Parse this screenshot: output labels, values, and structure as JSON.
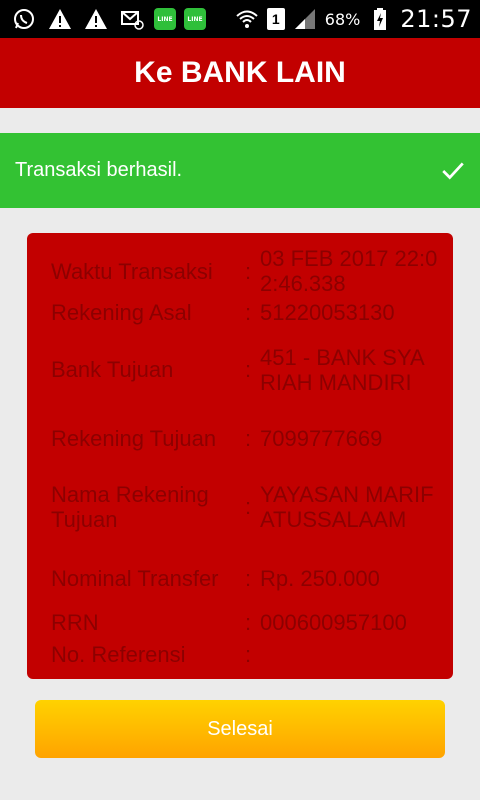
{
  "status_bar": {
    "battery_percent": "68%",
    "time": "21:57",
    "sim_label": "1",
    "line_label": "LINE"
  },
  "header": {
    "title": "Ke BANK LAIN"
  },
  "banner": {
    "message": "Transaksi berhasil."
  },
  "details": {
    "waktu": {
      "label": "Waktu Transaksi",
      "value": "03 FEB 2017 22:02:46.338"
    },
    "asal": {
      "label": "Rekening Asal",
      "value": "51220053130"
    },
    "bank": {
      "label": "Bank Tujuan",
      "value": "451 - BANK SYARIAH MANDIRI"
    },
    "rek_tujuan": {
      "label": "Rekening Tujuan",
      "value": "7099777669"
    },
    "nama": {
      "label": "Nama Rekening Tujuan",
      "value": "YAYASAN MARIFATUSSALAAM"
    },
    "nominal": {
      "label": "Nominal Transfer",
      "value": "Rp. 250.000"
    },
    "rrn": {
      "label": "RRN",
      "value": "000600957100"
    },
    "ref": {
      "label": "No. Referensi",
      "value": ""
    },
    "separator": ":"
  },
  "button": {
    "label": "Selesai"
  },
  "colors": {
    "header": "#c20000",
    "banner": "#33c233",
    "card": "#c20000",
    "card_text": "#8c0000",
    "button_top": "#ffd200",
    "button_bottom": "#ffa300"
  }
}
